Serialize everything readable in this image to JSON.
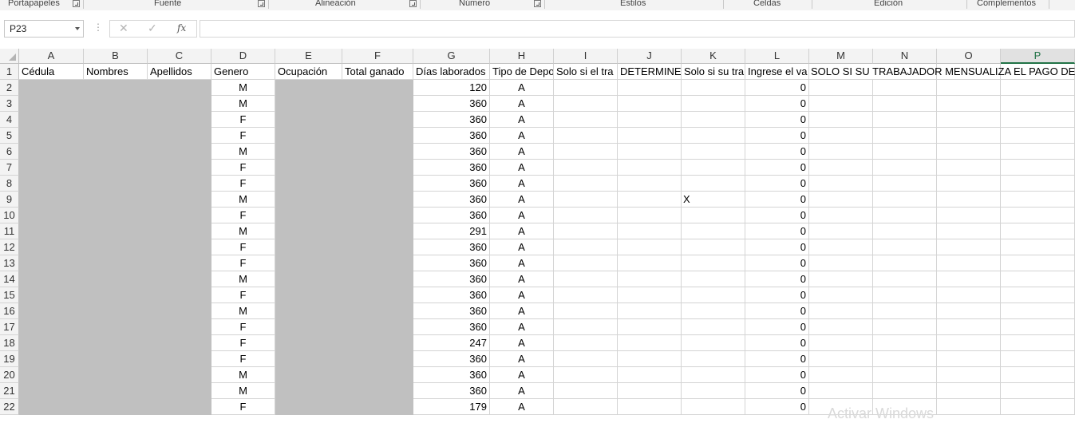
{
  "ribbon": {
    "groups": [
      {
        "label": "Portapapeles"
      },
      {
        "label": "Fuente"
      },
      {
        "label": "Alineación"
      },
      {
        "label": "Número"
      },
      {
        "label": "Estilos"
      },
      {
        "label": "Celdas"
      },
      {
        "label": "Edición"
      },
      {
        "label": "Complementos"
      }
    ]
  },
  "formula_bar": {
    "name_box": "P23",
    "formula_value": "",
    "icons": [
      "cancel-icon",
      "enter-icon",
      "fx-icon"
    ]
  },
  "sheet": {
    "selected_column": "P",
    "columns": [
      "A",
      "B",
      "C",
      "D",
      "E",
      "F",
      "G",
      "H",
      "I",
      "J",
      "K",
      "L",
      "M",
      "N",
      "O",
      "P"
    ],
    "header_row": [
      "Cédula",
      "Nombres",
      "Apellidos",
      "Genero",
      "Ocupación",
      "Total ganado",
      "Días laborados",
      "Tipo de Depo",
      "Solo si el tra",
      "DETERMINE L",
      "Solo si su tra",
      "Ingrese el va",
      "SOLO SI SU TRABAJADOR MENSUALIZA EL PAGO DE LA",
      "",
      "",
      ""
    ],
    "row_numbers": [
      "1",
      "2",
      "3",
      "4",
      "5",
      "6",
      "7",
      "8",
      "9",
      "10",
      "11",
      "12",
      "13",
      "14",
      "15",
      "16",
      "17",
      "18",
      "19",
      "20",
      "21",
      "22"
    ],
    "rows": [
      {
        "D": "M",
        "G": "120",
        "H": "A",
        "K": "",
        "L": "0"
      },
      {
        "D": "M",
        "G": "360",
        "H": "A",
        "K": "",
        "L": "0"
      },
      {
        "D": "F",
        "G": "360",
        "H": "A",
        "K": "",
        "L": "0"
      },
      {
        "D": "F",
        "G": "360",
        "H": "A",
        "K": "",
        "L": "0"
      },
      {
        "D": "M",
        "G": "360",
        "H": "A",
        "K": "",
        "L": "0"
      },
      {
        "D": "F",
        "G": "360",
        "H": "A",
        "K": "",
        "L": "0"
      },
      {
        "D": "F",
        "G": "360",
        "H": "A",
        "K": "",
        "L": "0"
      },
      {
        "D": "M",
        "G": "360",
        "H": "A",
        "K": "X",
        "L": "0"
      },
      {
        "D": "F",
        "G": "360",
        "H": "A",
        "K": "",
        "L": "0"
      },
      {
        "D": "M",
        "G": "291",
        "H": "A",
        "K": "",
        "L": "0"
      },
      {
        "D": "F",
        "G": "360",
        "H": "A",
        "K": "",
        "L": "0"
      },
      {
        "D": "F",
        "G": "360",
        "H": "A",
        "K": "",
        "L": "0"
      },
      {
        "D": "M",
        "G": "360",
        "H": "A",
        "K": "",
        "L": "0"
      },
      {
        "D": "F",
        "G": "360",
        "H": "A",
        "K": "",
        "L": "0"
      },
      {
        "D": "M",
        "G": "360",
        "H": "A",
        "K": "",
        "L": "0"
      },
      {
        "D": "F",
        "G": "360",
        "H": "A",
        "K": "",
        "L": "0"
      },
      {
        "D": "F",
        "G": "247",
        "H": "A",
        "K": "",
        "L": "0"
      },
      {
        "D": "F",
        "G": "360",
        "H": "A",
        "K": "",
        "L": "0"
      },
      {
        "D": "M",
        "G": "360",
        "H": "A",
        "K": "",
        "L": "0"
      },
      {
        "D": "M",
        "G": "360",
        "H": "A",
        "K": "",
        "L": "0"
      },
      {
        "D": "F",
        "G": "179",
        "H": "A",
        "K": "",
        "L": "0"
      }
    ],
    "redacted_columns": [
      "A",
      "B",
      "C",
      "E",
      "F"
    ],
    "redaction_color": "#c0c0c0"
  },
  "watermark": "Activar Windows",
  "colors": {
    "accent": "#217346"
  }
}
